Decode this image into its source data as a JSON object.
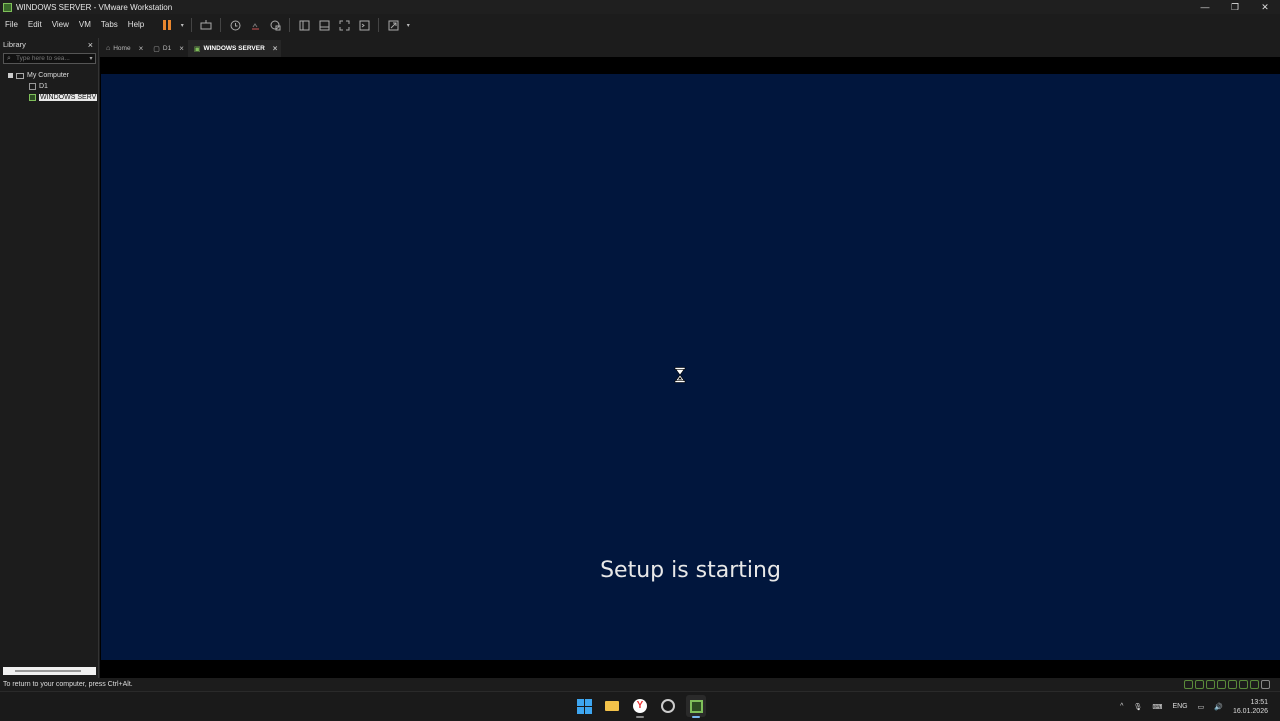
{
  "window": {
    "title": "WINDOWS SERVER - VMware Workstation",
    "controls": [
      "—",
      "❐",
      "✕"
    ]
  },
  "menu": [
    "File",
    "Edit",
    "View",
    "VM",
    "Tabs",
    "Help"
  ],
  "library": {
    "title": "Library",
    "search_placeholder": "Type here to sea...",
    "tree": {
      "root": "My Computer",
      "items": [
        "D1",
        "WINDOWS SERV"
      ]
    }
  },
  "tabs": [
    {
      "label": "Home",
      "active": false
    },
    {
      "label": "D1",
      "active": false
    },
    {
      "label": "WINDOWS SERVER",
      "active": true
    }
  ],
  "vm_screen": {
    "message": "Setup is starting",
    "background_color": "#01163d"
  },
  "statusbar": {
    "message": "To return to your computer, press Ctrl+Alt."
  },
  "taskbar": {
    "language": "ENG",
    "time": "13:51",
    "date": "16.01.2026"
  },
  "colors": {
    "accent_pause": "#e8862e",
    "vm_running": "#7fbf5a"
  }
}
